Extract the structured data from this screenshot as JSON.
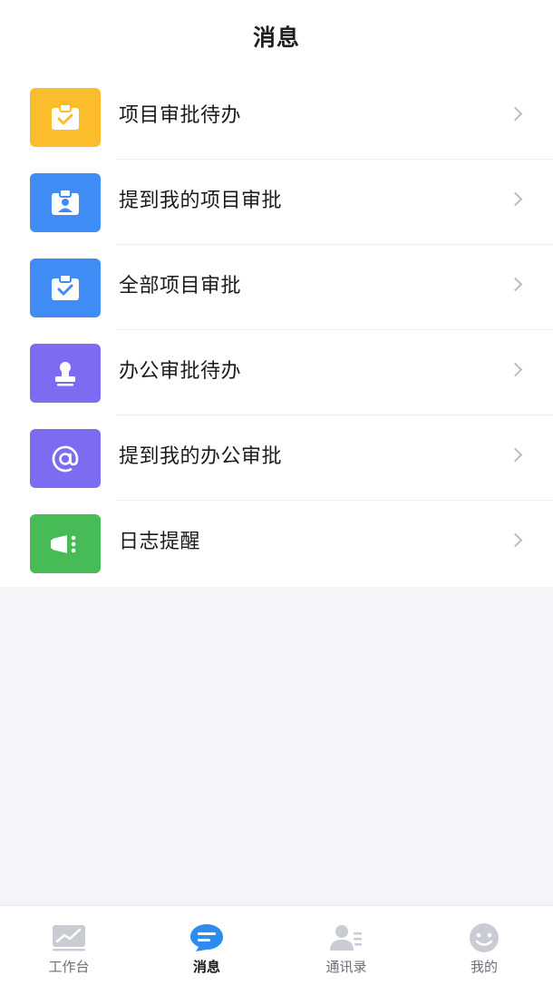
{
  "header": {
    "title": "消息"
  },
  "list": {
    "items": [
      {
        "label": "项目审批待办",
        "icon": "clipboard-check-icon",
        "color": "#fbbd2c"
      },
      {
        "label": "提到我的项目审批",
        "icon": "clipboard-person-icon",
        "color": "#3f8cf5"
      },
      {
        "label": "全部项目审批",
        "icon": "clipboard-check-icon",
        "color": "#3f8cf5"
      },
      {
        "label": "办公审批待办",
        "icon": "stamp-icon",
        "color": "#7b6cf2"
      },
      {
        "label": "提到我的办公审批",
        "icon": "at-icon",
        "color": "#7b6cf2"
      },
      {
        "label": "日志提醒",
        "icon": "log-reminder-icon",
        "color": "#46bb56"
      }
    ]
  },
  "tabbar": {
    "items": [
      {
        "label": "工作台",
        "icon": "chart-icon"
      },
      {
        "label": "消息",
        "icon": "message-icon",
        "active": true
      },
      {
        "label": "通讯录",
        "icon": "contacts-icon"
      },
      {
        "label": "我的",
        "icon": "profile-icon"
      }
    ]
  },
  "colors": {
    "active_tab": "#2d8cf0",
    "inactive_icon": "#c9ccd3"
  }
}
